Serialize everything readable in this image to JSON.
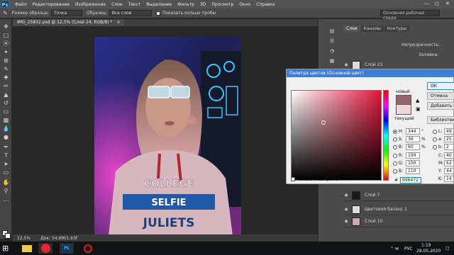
{
  "menubar": {
    "logo": "Ps",
    "items": [
      "Файл",
      "Редактирование",
      "Изображение",
      "Слои",
      "Текст",
      "Выделение",
      "Фильтр",
      "3D",
      "Просмотр",
      "Окно",
      "Справка"
    ]
  },
  "options_bar": {
    "size_label": "Размер образца:",
    "size_value": "Точка",
    "sample_label": "Образец:",
    "sample_value": "Все слои",
    "show_ring_label": "Показать кольцо пробы",
    "workspace": "Основная рабочая среда"
  },
  "document": {
    "tab_title": "IMG_25832.psd @ 12,5% (Слой 24, RGB/8) *",
    "zoom": "12,5%",
    "doc_size": "Док: 54,8M/1,63Г"
  },
  "panels": {
    "tabs": [
      "Слои",
      "Каналы",
      "Контуры"
    ],
    "layers": [
      {
        "name": "Слой 23"
      },
      {
        "name": "Слой 7"
      },
      {
        "name": "Цветовой баланс 1"
      },
      {
        "name": "Слой 10"
      }
    ],
    "opacity_label": "Непрозрачность:",
    "fill_label": "Заливка:"
  },
  "color_picker": {
    "title": "Палитра цветов (Основной цвет)",
    "new_label": "новый",
    "current_label": "текущий",
    "ok": "ОК",
    "cancel": "Отмена",
    "add_to_swatches": "Добавить в образцы",
    "libraries": "Библиотеки цветов",
    "only_web": "Только Web-цвета",
    "new_color": "#956467",
    "current_color": "#efd7da",
    "fields": {
      "H": {
        "value": "344",
        "unit": "°"
      },
      "S": {
        "value": "36",
        "unit": "%"
      },
      "B": {
        "value": "60",
        "unit": "%"
      },
      "R": {
        "value": "150"
      },
      "G": {
        "value": "100"
      },
      "Bl": {
        "value": "110"
      },
      "L": {
        "value": "49"
      },
      "a": {
        "value": "25"
      },
      "b": {
        "value": "2"
      },
      "C": {
        "value": "40"
      },
      "M": {
        "value": "62"
      },
      "Y": {
        "value": "44"
      },
      "K": {
        "value": "14"
      }
    },
    "hex": "956472"
  },
  "taskbar": {
    "lang": "РУС",
    "time": "1:19",
    "date": "28.05.2020"
  }
}
